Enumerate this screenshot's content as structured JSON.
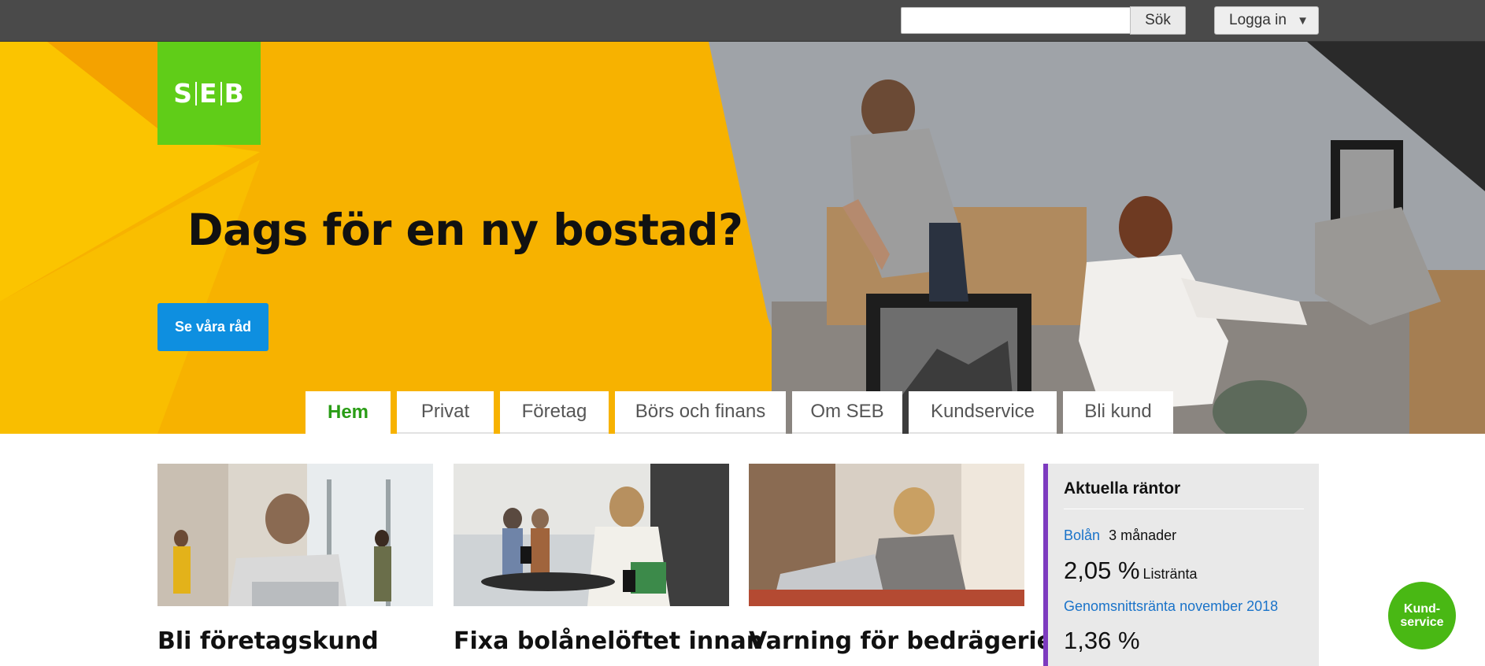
{
  "topbar": {
    "search_placeholder": "",
    "search_button": "Sök",
    "login_button": "Logga in",
    "login_caret": "▼"
  },
  "hero": {
    "logo_left": "S",
    "logo_mid": "E",
    "logo_right": "B",
    "title": "Dags för en ny bostad?",
    "cta": "Se våra råd",
    "accent_color": "#f7b200",
    "logo_color": "#60cd18",
    "cta_color": "#0e8fe0"
  },
  "tabs": [
    {
      "label": "Hem",
      "active": true
    },
    {
      "label": "Privat"
    },
    {
      "label": "Företag"
    },
    {
      "label": "Börs och finans"
    },
    {
      "label": "Om SEB"
    },
    {
      "label": "Kundservice"
    },
    {
      "label": "Bli kund"
    }
  ],
  "cards": [
    {
      "title": "Bli företagskund",
      "image": "businessman-office-photo"
    },
    {
      "title": "Fixa bolånelöftet innan",
      "image": "woman-cafe-photo"
    },
    {
      "title": "Varning för bedrägerier",
      "image": "woman-laptop-photo"
    }
  ],
  "rates": {
    "title": "Aktuella räntor",
    "row1_link": "Bolån",
    "row1_text": "3 månader",
    "row1_value": "2,05 %",
    "row1_value_label": "Listränta",
    "row2_link": "Genomsnittsränta november 2018",
    "row2_value": "1,36 %",
    "accent_color": "#7d3bbf"
  },
  "kundservice": {
    "line1": "Kund-",
    "line2": "service",
    "color": "#49b814"
  }
}
